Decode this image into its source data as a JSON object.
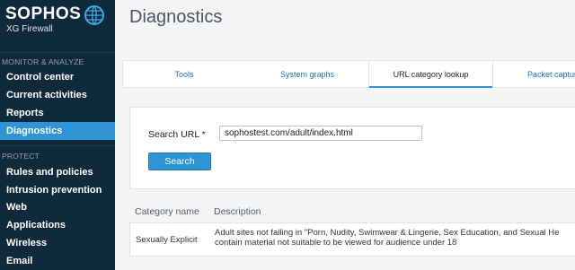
{
  "brand": {
    "name": "SOPHOS",
    "product": "XG Firewall"
  },
  "sidebar": {
    "sections": [
      {
        "label": "MONITOR & ANALYZE"
      },
      {
        "label": "PROTECT"
      }
    ],
    "items": [
      {
        "label": "Control center"
      },
      {
        "label": "Current activities"
      },
      {
        "label": "Reports"
      },
      {
        "label": "Diagnostics",
        "active": true
      },
      {
        "label": "Rules and policies"
      },
      {
        "label": "Intrusion prevention"
      },
      {
        "label": "Web"
      },
      {
        "label": "Applications"
      },
      {
        "label": "Wireless"
      },
      {
        "label": "Email"
      }
    ]
  },
  "page": {
    "title": "Diagnostics"
  },
  "tabs": [
    {
      "label": "Tools"
    },
    {
      "label": "System graphs"
    },
    {
      "label": "URL category lookup",
      "active": true
    },
    {
      "label": "Packet capture"
    }
  ],
  "form": {
    "search_url_label": "Search URL *",
    "search_url_value": "sophostest.com/adult/index.html",
    "search_button": "Search"
  },
  "results": {
    "columns": [
      "Category name",
      "Description"
    ],
    "rows": [
      {
        "category": "Sexually Explicit",
        "description": "Adult sites not falling in \"Porn, Nudity, Swimwear & Lingerie, Sex Education, and Sexual He\ncontain material not suitable to be viewed for audience under 18"
      }
    ]
  },
  "colors": {
    "sidebar_bg": "#102a3d",
    "accent": "#2e94d6",
    "link": "#1a74b8"
  }
}
